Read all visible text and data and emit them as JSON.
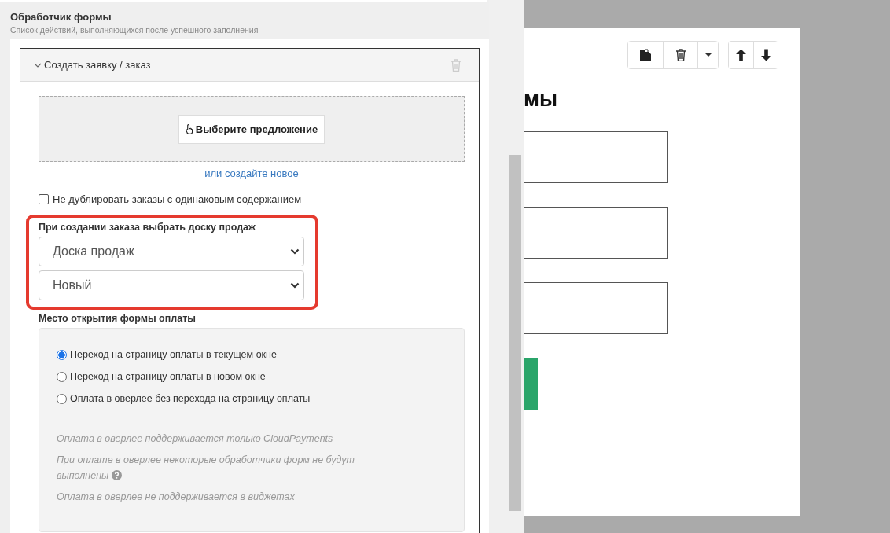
{
  "panel": {
    "title": "Обработчик формы",
    "subtitle": "Список действий, выполняющихся после успешного заполнения"
  },
  "handler": {
    "title": "Создать заявку / заказ",
    "expanded": true,
    "offer_button": "Выберите предложение",
    "create_link": "или создайте новое",
    "dedupe": {
      "label": "Не дублировать заказы с одинаковым содержанием",
      "checked": false
    },
    "board": {
      "label": "При создании заказа выбрать доску продаж",
      "selects": [
        {
          "value": "Доска продаж"
        },
        {
          "value": "Новый"
        }
      ]
    },
    "payment": {
      "label": "Место открытия формы оплаты",
      "options": [
        {
          "label": "Переход на страницу оплаты в текущем окне",
          "selected": true
        },
        {
          "label": "Переход на страницу оплаты в новом окне",
          "selected": false
        },
        {
          "label": "Оплата в оверлее без перехода на страницу оплаты",
          "selected": false
        }
      ],
      "notes": [
        {
          "text": "Оплата в оверлее поддерживается только CloudPayments",
          "help": false
        },
        {
          "text": "При оплате в оверлее некоторые обработчики форм не будут выполнены",
          "help": true
        },
        {
          "text": "Оплата в оверлее не поддерживается в виджетах",
          "help": false
        }
      ]
    }
  },
  "canvas": {
    "toolbar": [
      [
        {
          "kind": "copy"
        },
        {
          "kind": "delete"
        },
        {
          "kind": "dropdown"
        }
      ],
      [
        {
          "kind": "up"
        },
        {
          "kind": "down"
        }
      ]
    ],
    "heading": "мы",
    "fields": [
      {
        "kind": "input"
      },
      {
        "kind": "input"
      },
      {
        "kind": "input"
      },
      {
        "kind": "button"
      }
    ]
  }
}
